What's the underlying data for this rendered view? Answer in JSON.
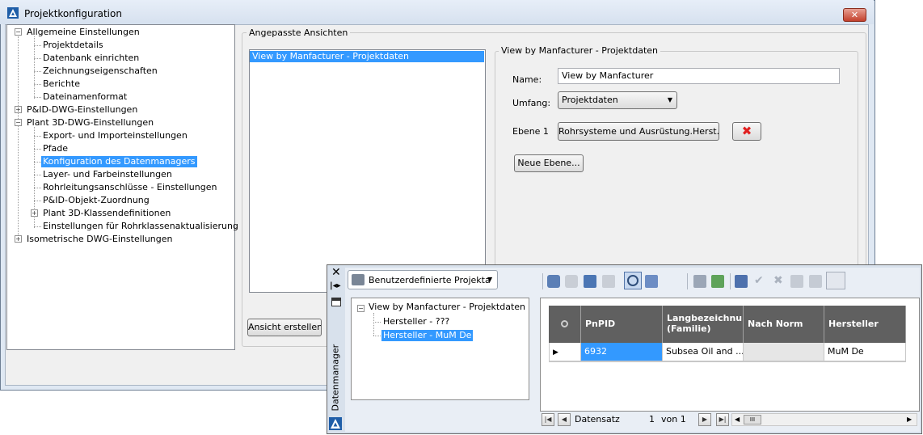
{
  "window": {
    "title": "Projektkonfiguration",
    "close_glyph": "✕"
  },
  "tree": {
    "items": [
      {
        "label": "Allgemeine Einstellungen"
      },
      {
        "label": "Projektdetails"
      },
      {
        "label": "Datenbank einrichten"
      },
      {
        "label": "Zeichnungseigenschaften"
      },
      {
        "label": "Berichte"
      },
      {
        "label": "Dateinamenformat"
      },
      {
        "label": "P&ID-DWG-Einstellungen"
      },
      {
        "label": "Plant 3D-DWG-Einstellungen"
      },
      {
        "label": "Export- und Importeinstellungen"
      },
      {
        "label": "Pfade"
      },
      {
        "label": "Konfiguration des Datenmanagers"
      },
      {
        "label": "Layer- und Farbeinstellungen"
      },
      {
        "label": "Rohrleitungsanschlüsse - Einstellungen"
      },
      {
        "label": "P&ID-Objekt-Zuordnung"
      },
      {
        "label": "Plant 3D-Klassendefinitionen"
      },
      {
        "label": "Einstellungen für Rohrklassenaktualisierung"
      },
      {
        "label": "Isometrische DWG-Einstellungen"
      }
    ]
  },
  "custom_views": {
    "group_label": "Angepasste Ansichten",
    "items": [
      "View by Manfacturer - Projektdaten"
    ],
    "create_button": "Ansicht erstellen"
  },
  "view_detail": {
    "group_label": "View by Manfacturer - Projektdaten",
    "name_label": "Name:",
    "name_value": "View by Manfacturer",
    "scope_label": "Umfang:",
    "scope_value": "Projektdaten",
    "level_label": "Ebene 1",
    "level_button": "Rohrsysteme  und Ausrüstung.Herst...",
    "delete_glyph": "✖",
    "new_level_button": "Neue Ebene..."
  },
  "datamanager": {
    "side_title": "Datenmanager",
    "dropdown_value": "Benutzerdefinierte Projekta",
    "tree": {
      "root": "View by Manfacturer - Projektdaten",
      "children": [
        "Hersteller - ???",
        "Hersteller - MuM De"
      ]
    },
    "grid": {
      "headers": [
        "PnPID",
        "Langbezeichnung (Familie)",
        "Nach Norm",
        "Hersteller"
      ],
      "header_line1": "Langbezeichnun",
      "header_line2": "(Familie)",
      "row": {
        "pnpid": "6932",
        "lang": "Subsea Oil and ...",
        "norm": "",
        "hersteller": "MuM De"
      }
    },
    "nav": {
      "label": "Datensatz",
      "current": "1",
      "of_label": "von 1",
      "scroll_glyph": "III"
    }
  },
  "colors": {
    "selection": "#3399ff",
    "accent": "#e02020"
  }
}
